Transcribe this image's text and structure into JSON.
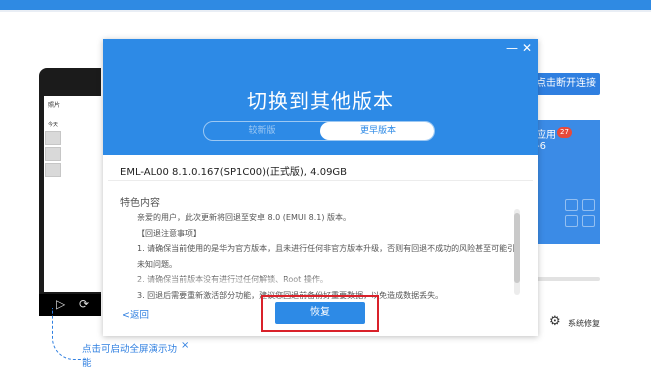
{
  "background_app": {
    "phone": {
      "album_title": "照片",
      "today_label": "今天"
    },
    "hint": {
      "text": "点击可启动全屏演示功能",
      "close": "×"
    },
    "disconnect_button": "点击断开连接",
    "panel": {
      "label": "应用",
      "badge": "27",
      "sub": "-6"
    },
    "system_repair": "系统修复"
  },
  "dialog": {
    "minimize": "—",
    "close": "✕",
    "title": "切换到其他版本",
    "tabs": [
      {
        "label": "较新版"
      },
      {
        "label": "更早版本"
      }
    ],
    "version": "EML-AL00 8.1.0.167(SP1C00)(正式版), 4.09GB",
    "features_title": "特色内容",
    "description_lines": [
      "亲爱的用户，此次更新将回退至安卓 8.0 (EMUI 8.1) 版本。",
      "【回退注意事项】",
      "1. 请确保当前使用的是华为官方版本，且未进行任何非官方版本升级，否则有回退不成功的风险甚至可能引入",
      "未知问题。",
      "2. 请确保当前版本没有进行过任何解锁、Root 操作。",
      "3. 回退后需要重新激活部分功能，建议您回退前备份好重要数据，以免造成数据丢失。"
    ],
    "back_link": "<返回",
    "restore_button": "恢复"
  },
  "colors": {
    "brand_blue": "#2d8ae6",
    "highlight_red": "#d9212a"
  }
}
